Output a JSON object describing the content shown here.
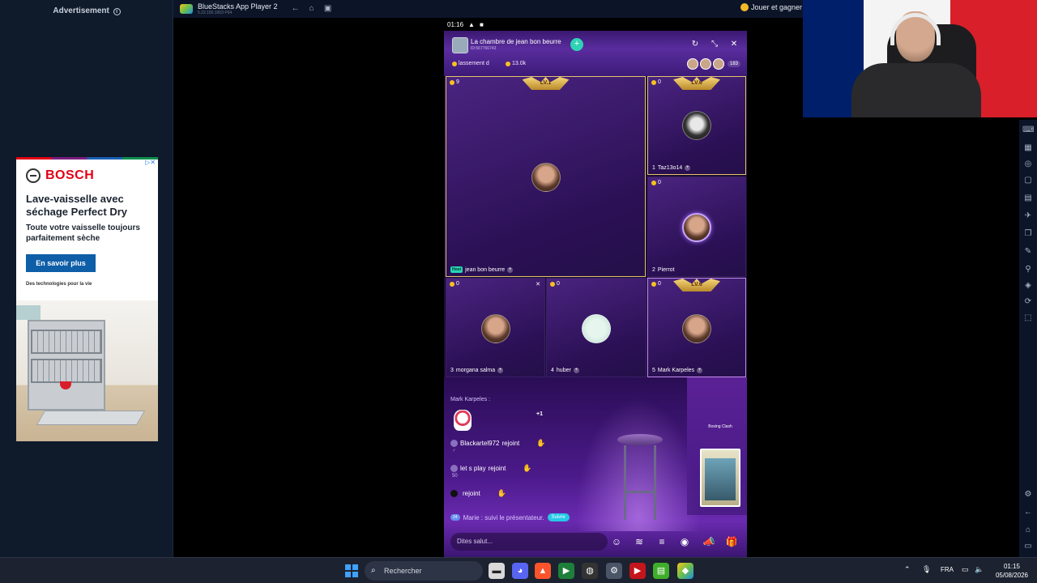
{
  "advert": {
    "label": "Advertisement",
    "brand": "BOSCH",
    "headline": "Lave-vaisselle avec séchage Perfect Dry",
    "subtitle": "Toute votre vaisselle toujours parfaitement sèche",
    "cta": "En savoir plus",
    "tagline": "Des technologies pour la vie"
  },
  "bluestacks": {
    "title": "BlueStacks App Player 2",
    "version": "5.22.150.1003 P64",
    "play_label": "Jouer et gagner"
  },
  "phone": {
    "status_time": "01:16",
    "room": {
      "title": "La chambre de jean bon beurre",
      "id": "ID:567766743",
      "ranking": "lassement d",
      "score": "13.0k",
      "viewer_count": "183"
    },
    "seats": [
      {
        "index": "",
        "coins": "9",
        "name": "jean bon beurre",
        "host": "Host",
        "badge": "LV.1"
      },
      {
        "index": "1",
        "coins": "0",
        "name": "Taz13o14",
        "badge": "LV.6"
      },
      {
        "index": "2",
        "coins": "0",
        "name": "Pierrot"
      },
      {
        "index": "3",
        "coins": "0",
        "name": "morgana salma"
      },
      {
        "index": "4",
        "coins": "0",
        "name": "huber"
      },
      {
        "index": "5",
        "coins": "0",
        "name": "Mark Karpeles",
        "badge": "LV.6"
      }
    ],
    "chat": {
      "welcome": "Mark Karpeles :",
      "plus_one": "+1",
      "lines": [
        {
          "user": "Blackartel972",
          "action": "rejoint",
          "sub": "♂"
        },
        {
          "user": "let s play",
          "action": "rejoint",
          "sub": "50"
        },
        {
          "user": "",
          "action": "rejoint",
          "sub": ""
        }
      ],
      "follow_level": "24",
      "follow_text": "Marie : suivi le présentateur.",
      "follow_chip": "Suivre",
      "event_label": "Boxing Clash"
    },
    "input_placeholder": "Dites salut..."
  },
  "taskbar": {
    "search_placeholder": "Rechercher",
    "language": "FRA",
    "time": "01:15",
    "date": "05/08/2026"
  },
  "colors": {
    "accent_teal": "#2fd3b4",
    "bosch_red": "#e20015",
    "cta_blue": "#0e5ea8"
  }
}
